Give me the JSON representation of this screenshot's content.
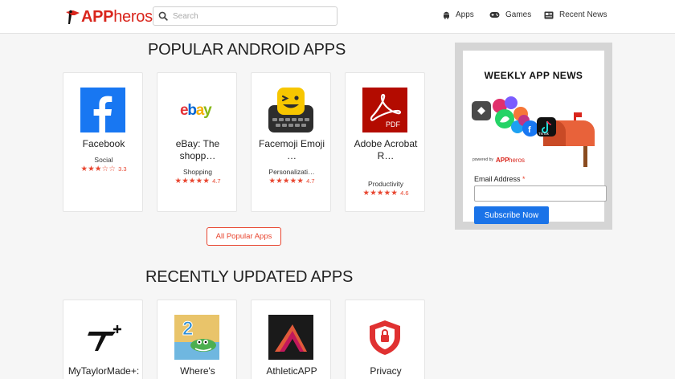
{
  "header": {
    "logo": {
      "text_bold": "APP",
      "text_light": "heros"
    },
    "search": {
      "placeholder": "Search"
    },
    "nav": [
      {
        "label": "Apps",
        "icon": "android-icon"
      },
      {
        "label": "Games",
        "icon": "gamepad-icon"
      },
      {
        "label": "Recent News",
        "icon": "newspaper-icon"
      }
    ]
  },
  "popular": {
    "title": "POPULAR ANDROID APPS",
    "apps": [
      {
        "name": "Facebook",
        "category": "Social",
        "stars": "★★★☆☆",
        "rating": "3.3",
        "icon": "facebook-icon"
      },
      {
        "name": "eBay: The shopp…",
        "category": "Shopping",
        "stars": "★★★★★",
        "rating": "4.7",
        "icon": "ebay-icon"
      },
      {
        "name": "Facemoji Emoji …",
        "category": "Personalizati…",
        "stars": "★★★★★",
        "rating": "4.7",
        "icon": "facemoji-icon"
      },
      {
        "name": "Adobe Acrobat R…",
        "category": "Productivity",
        "stars": "★★★★★",
        "rating": "4.6",
        "icon": "adobe-acrobat-icon"
      }
    ],
    "all_button": "All Popular Apps"
  },
  "recent": {
    "title": "RECENTLY UPDATED APPS",
    "apps": [
      {
        "name": "MyTaylorMade+:",
        "icon": "taylormade-icon"
      },
      {
        "name": "Where's",
        "icon": "wheres-my-water-icon"
      },
      {
        "name": "AthleticAPP",
        "icon": "athleticapp-icon"
      },
      {
        "name": "Privacy",
        "icon": "privacy-shield-icon"
      }
    ]
  },
  "newsletter": {
    "title": "WEEKLY APP NEWS",
    "powered_by": "powered by",
    "powered_logo_bold": "APP",
    "powered_logo_light": "heros",
    "email_label": "Email Address",
    "required_mark": "*",
    "subscribe_label": "Subscribe Now"
  },
  "colors": {
    "brand_red": "#d9251c",
    "star_red": "#e8452f",
    "subscribe_blue": "#1a73e8"
  }
}
